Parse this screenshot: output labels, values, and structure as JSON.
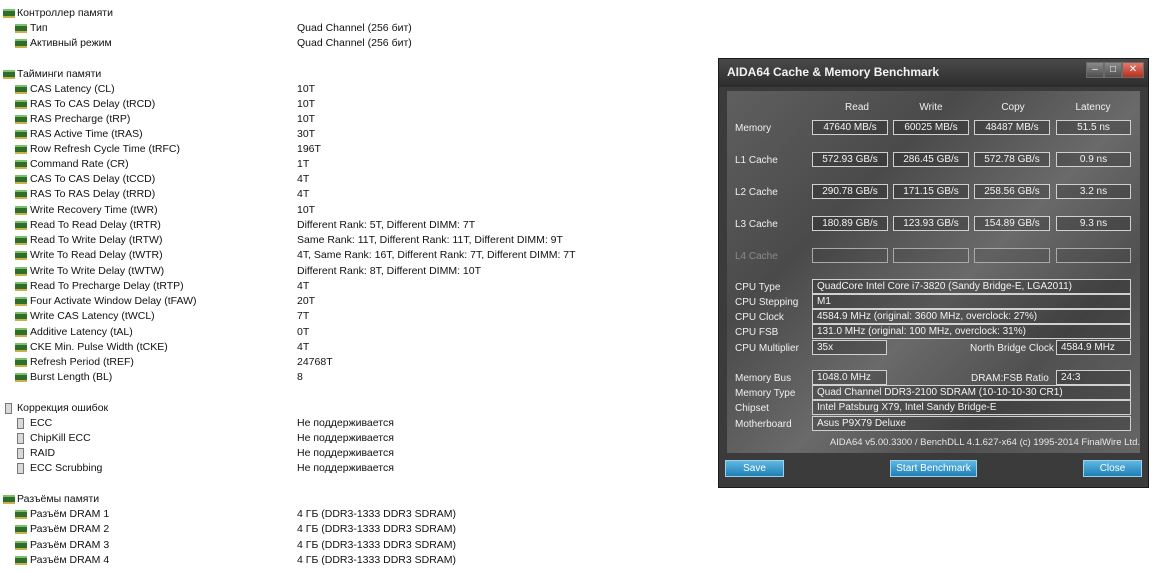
{
  "memory_controller": {
    "header": "Контроллер памяти",
    "rows": [
      {
        "label": "Тип",
        "value": "Quad Channel  (256 бит)"
      },
      {
        "label": "Активный режим",
        "value": "Quad Channel  (256 бит)"
      }
    ]
  },
  "timings": {
    "header": "Тайминги памяти",
    "rows": [
      {
        "label": "CAS Latency (CL)",
        "value": "10T"
      },
      {
        "label": "RAS To CAS Delay (tRCD)",
        "value": "10T"
      },
      {
        "label": "RAS Precharge (tRP)",
        "value": "10T"
      },
      {
        "label": "RAS Active Time (tRAS)",
        "value": "30T"
      },
      {
        "label": "Row Refresh Cycle Time (tRFC)",
        "value": "196T"
      },
      {
        "label": "Command Rate (CR)",
        "value": "1T"
      },
      {
        "label": "CAS To CAS Delay (tCCD)",
        "value": "4T"
      },
      {
        "label": "RAS To RAS Delay (tRRD)",
        "value": "4T"
      },
      {
        "label": "Write Recovery Time (tWR)",
        "value": "10T"
      },
      {
        "label": "Read To Read Delay (tRTR)",
        "value": "Different Rank: 5T, Different DIMM: 7T"
      },
      {
        "label": "Read To Write Delay (tRTW)",
        "value": "Same Rank: 11T, Different Rank: 11T, Different DIMM: 9T"
      },
      {
        "label": "Write To Read Delay (tWTR)",
        "value": "4T, Same Rank: 16T, Different Rank: 7T, Different DIMM: 7T"
      },
      {
        "label": "Write To Write Delay (tWTW)",
        "value": "Different Rank: 8T, Different DIMM: 10T"
      },
      {
        "label": "Read To Precharge Delay (tRTP)",
        "value": "4T"
      },
      {
        "label": "Four Activate Window Delay (tFAW)",
        "value": "20T"
      },
      {
        "label": "Write CAS Latency (tWCL)",
        "value": "7T"
      },
      {
        "label": "Additive Latency (tAL)",
        "value": "0T"
      },
      {
        "label": "CKE Min. Pulse Width (tCKE)",
        "value": "4T"
      },
      {
        "label": "Refresh Period (tREF)",
        "value": "24768T"
      },
      {
        "label": "Burst Length (BL)",
        "value": "8"
      }
    ]
  },
  "error_correction": {
    "header": "Коррекция ошибок",
    "rows": [
      {
        "label": "ECC",
        "value": "Не поддерживается"
      },
      {
        "label": "ChipKill ECC",
        "value": "Не поддерживается"
      },
      {
        "label": "RAID",
        "value": "Не поддерживается"
      },
      {
        "label": "ECC Scrubbing",
        "value": "Не поддерживается"
      }
    ]
  },
  "slots": {
    "header": "Разъёмы памяти",
    "rows": [
      {
        "label": "Разъём DRAM 1",
        "value": "4 ГБ  (DDR3-1333 DDR3 SDRAM)"
      },
      {
        "label": "Разъём DRAM 2",
        "value": "4 ГБ  (DDR3-1333 DDR3 SDRAM)"
      },
      {
        "label": "Разъём DRAM 3",
        "value": "4 ГБ  (DDR3-1333 DDR3 SDRAM)"
      },
      {
        "label": "Разъём DRAM 4",
        "value": "4 ГБ  (DDR3-1333 DDR3 SDRAM)"
      }
    ]
  },
  "benchmark": {
    "title": "AIDA64 Cache & Memory Benchmark",
    "window_buttons": {
      "minimize": "–",
      "maximize": "□",
      "close": "✕"
    },
    "columns": [
      "Read",
      "Write",
      "Copy",
      "Latency"
    ],
    "rows": [
      {
        "label": "Memory",
        "values": [
          "47640 MB/s",
          "60025 MB/s",
          "48487 MB/s",
          "51.5 ns"
        ]
      },
      {
        "label": "L1 Cache",
        "values": [
          "572.93 GB/s",
          "286.45 GB/s",
          "572.78 GB/s",
          "0.9 ns"
        ]
      },
      {
        "label": "L2 Cache",
        "values": [
          "290.78 GB/s",
          "171.15 GB/s",
          "258.56 GB/s",
          "3.2 ns"
        ]
      },
      {
        "label": "L3 Cache",
        "values": [
          "180.89 GB/s",
          "123.93 GB/s",
          "154.89 GB/s",
          "9.3 ns"
        ]
      },
      {
        "label": "L4 Cache",
        "values": [
          "",
          "",
          "",
          ""
        ]
      }
    ],
    "cpu_type": {
      "label": "CPU Type",
      "value": "QuadCore Intel Core i7-3820  (Sandy Bridge-E, LGA2011)"
    },
    "cpu_stepping": {
      "label": "CPU Stepping",
      "value": "M1"
    },
    "cpu_clock": {
      "label": "CPU Clock",
      "value": "4584.9 MHz  (original: 3600 MHz, overclock: 27%)"
    },
    "cpu_fsb": {
      "label": "CPU FSB",
      "value": "131.0 MHz  (original: 100 MHz, overclock: 31%)"
    },
    "cpu_multiplier": {
      "label": "CPU Multiplier",
      "value": "35x"
    },
    "north_bridge_clock": {
      "label": "North Bridge Clock",
      "value": "4584.9 MHz"
    },
    "memory_bus": {
      "label": "Memory Bus",
      "value": "1048.0 MHz"
    },
    "dram_fsb_ratio": {
      "label": "DRAM:FSB Ratio",
      "value": "24:3"
    },
    "memory_type": {
      "label": "Memory Type",
      "value": "Quad Channel DDR3-2100 SDRAM  (10-10-10-30 CR1)"
    },
    "chipset": {
      "label": "Chipset",
      "value": "Intel Patsburg X79, Intel Sandy Bridge-E"
    },
    "motherboard": {
      "label": "Motherboard",
      "value": "Asus P9X79 Deluxe"
    },
    "copyright": "AIDA64 v5.00.3300 / BenchDLL 4.1.627-x64  (c) 1995-2014 FinalWire Ltd.",
    "buttons": {
      "save": "Save",
      "start": "Start Benchmark",
      "close": "Close"
    }
  }
}
